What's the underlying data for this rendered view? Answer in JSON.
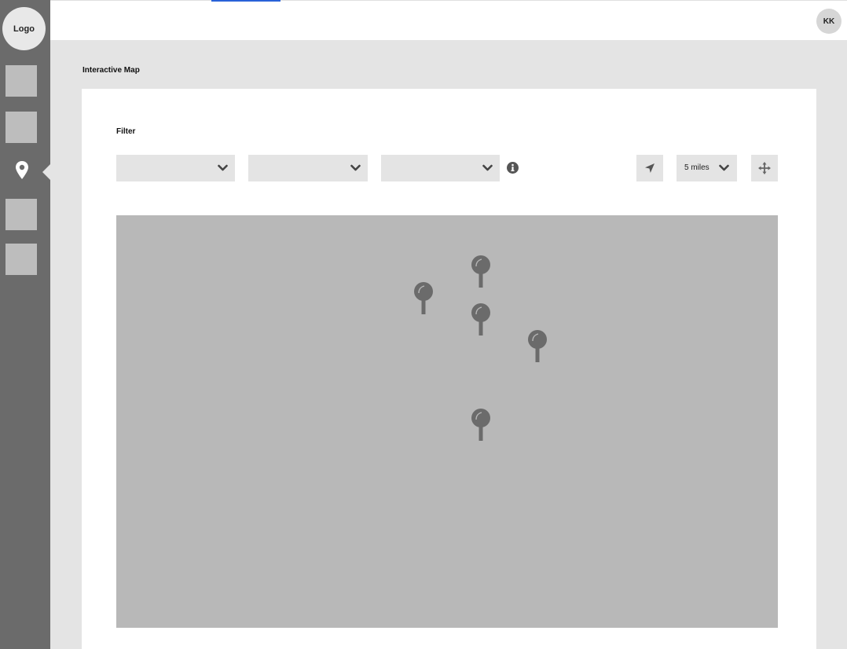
{
  "sidebar": {
    "logo_label": "Logo",
    "nav_items": [
      "placeholder-1",
      "placeholder-2",
      "map-pin",
      "placeholder-3",
      "placeholder-4"
    ]
  },
  "header": {
    "avatar_initials": "KK"
  },
  "page": {
    "title": "Interactive Map"
  },
  "filters": {
    "label": "Filter",
    "dropdown_1": "",
    "dropdown_2": "",
    "dropdown_3": "",
    "radius_label": "5 miles",
    "icons": [
      "chevron-down-icon",
      "info-icon",
      "location-arrow-icon",
      "move-icon"
    ]
  },
  "map": {
    "pin_count": 5
  },
  "colors": {
    "sidebar": "#6b6b6b",
    "map": "#b8b8b8",
    "control": "#e4e4e4",
    "pin": "#6b6b6b",
    "accent_link": "#2962d8"
  }
}
